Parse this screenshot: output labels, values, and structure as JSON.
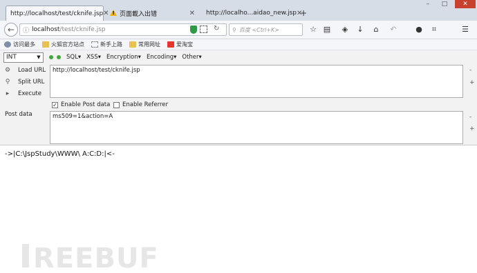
{
  "tabs": [
    {
      "label": "http://localhost/test/cknife.jsp",
      "active": true
    },
    {
      "label": "页面載入出错",
      "icon": "warning-icon"
    },
    {
      "label": "http://localho...aidao_new.jsp"
    }
  ],
  "window_controls": {
    "minimize": "–",
    "maximize": "□",
    "close": "✕"
  },
  "nav": {
    "url_host": "localhost",
    "url_path": "/test/cknife.jsp",
    "search_placeholder": "百度 <Ctrl+K>"
  },
  "bookmarks": [
    "访问最多",
    "火狐官方站点",
    "新手上路",
    "常用网址",
    "爱淘宝"
  ],
  "hackbar": {
    "select_value": "INT",
    "menus": [
      "SQL",
      "XSS",
      "Encryption",
      "Encoding",
      "Other"
    ]
  },
  "actions": {
    "load": "Load URL",
    "split": "Split URL",
    "execute": "Execute"
  },
  "url_field": "http://localhost/test/cknife.jsp",
  "options": {
    "post_label": "Enable Post data",
    "post_checked": true,
    "referrer_label": "Enable Referrer",
    "referrer_checked": false
  },
  "post": {
    "label": "Post data",
    "value": "ms509=1&action=A"
  },
  "output": "->|C:\\JspStudy\\WWW\\ A:C:D:|<-",
  "watermark": "REEBUF",
  "colors": {
    "accent": "#2e9a45",
    "close": "#c8402e"
  }
}
